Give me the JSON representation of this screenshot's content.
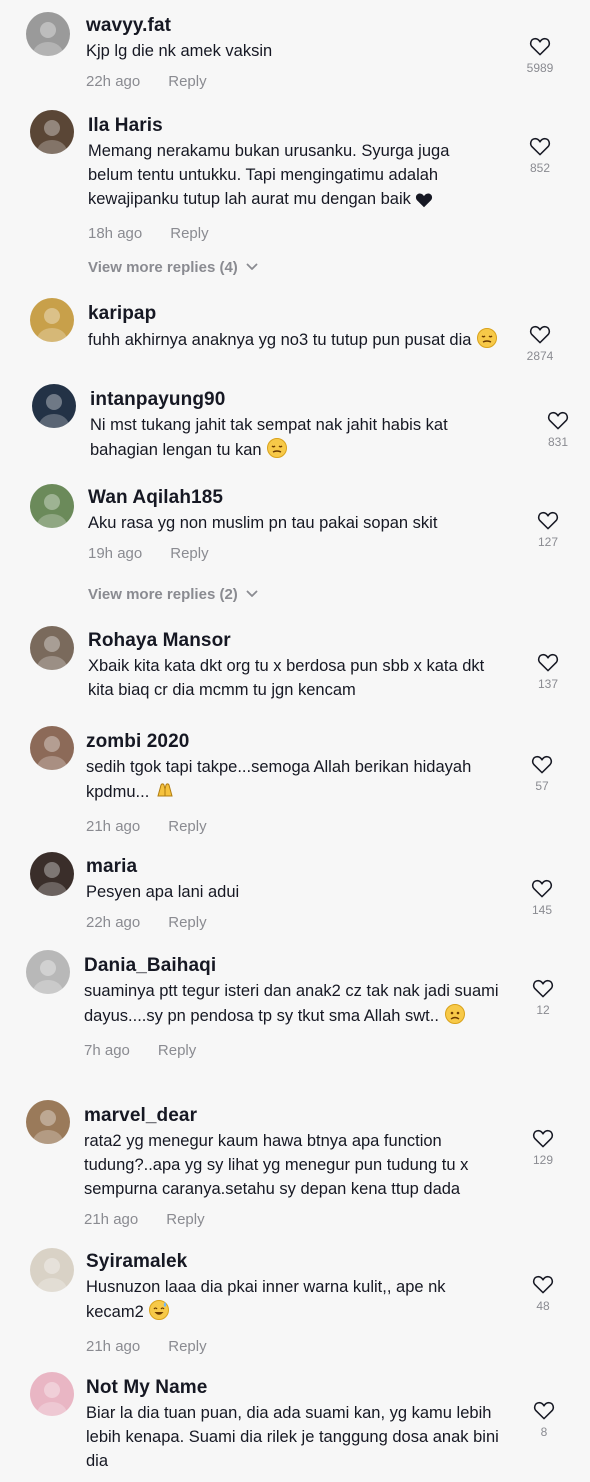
{
  "comments": [
    {
      "username": "wavyy.fat",
      "text": "Kjp lg die nk amek vaksin",
      "time": "22h ago",
      "reply": "Reply",
      "likes": "5989",
      "avatar_color": "#9a9a9a"
    },
    {
      "username": "Ila Haris",
      "text": "Memang nerakamu bukan urusanku. Syurga juga belum tentu untukku. Tapi mengingatimu adalah kewajipanku tutup lah aurat mu dengan baik",
      "text_emoji": "black-heart",
      "time": "18h ago",
      "reply": "Reply",
      "likes": "852",
      "more": "View more replies (4)",
      "avatar_color": "#5a4636"
    },
    {
      "username": "karipap",
      "text": "fuhh akhirnya anaknya yg no3 tu tutup pun pusat dia",
      "text_emoji": "pensive-face",
      "likes": "2874",
      "avatar_color": "#c8a04a"
    },
    {
      "username": "intanpayung90",
      "text": "Ni mst tukang jahit tak sempat nak jahit habis kat bahagian lengan tu kan",
      "text_emoji": "pensive-face",
      "likes": "831",
      "avatar_color": "#233246"
    },
    {
      "username": "Wan Aqilah185",
      "text": "Aku rasa yg non muslim pn tau pakai sopan skit",
      "time": "19h ago",
      "reply": "Reply",
      "likes": "127",
      "more": "View more replies (2)",
      "avatar_color": "#6b8a5a"
    },
    {
      "username": "Rohaya Mansor",
      "text": "Xbaik kita kata dkt org tu x berdosa pun sbb x kata dkt kita biaq cr dia mcmm tu jgn kencam",
      "likes": "137",
      "avatar_color": "#7a6a5c"
    },
    {
      "username": "zombi 2020",
      "text": "sedih tgok tapi takpe...semoga Allah berikan hidayah kpdmu...",
      "text_emoji": "folded-hands",
      "time": "21h ago",
      "reply": "Reply",
      "likes": "57",
      "avatar_color": "#8c6a58"
    },
    {
      "username": "maria",
      "text": "Pesyen apa lani adui",
      "time": "22h ago",
      "reply": "Reply",
      "likes": "145",
      "avatar_color": "#3a2e2a"
    },
    {
      "username": "Dania_Baihaqi",
      "text": "suaminya ptt tegur isteri dan anak2 cz tak nak jadi suami dayus....sy pn pendosa tp sy tkut sma Allah swt..",
      "text_emoji": "worried-face",
      "time": "7h ago",
      "reply": "Reply",
      "likes": "12",
      "avatar_color": "#b8b8b8"
    },
    {
      "username": "marvel_dear",
      "text": "rata2 yg menegur kaum hawa btnya apa function tudung?..apa yg sy lihat yg menegur pun tudung tu x sempurna caranya.setahu sy depan kena ttup dada",
      "time": "21h ago",
      "reply": "Reply",
      "likes": "129",
      "avatar_color": "#9a7a5a"
    },
    {
      "username": "Syiramalek",
      "text": "Husnuzon laaa dia pkai inner warna kulit,, ape nk kecam2",
      "text_emoji": "sweat-smile",
      "time": "21h ago",
      "reply": "Reply",
      "likes": "48",
      "avatar_color": "#d9d2c6"
    },
    {
      "username": "Not My Name",
      "text": "Biar la dia tuan puan, dia ada suami kan, yg kamu lebih lebih kenapa. Suami dia rilek je tanggung dosa anak bini dia",
      "likes": "8",
      "avatar_color": "#e9b6c4"
    }
  ],
  "colors": {
    "muted": "#8a8b91",
    "text": "#161823",
    "background": "#f7f7f7"
  },
  "icons": {
    "like": "heart-outline-icon",
    "expand": "chevron-down-icon"
  }
}
